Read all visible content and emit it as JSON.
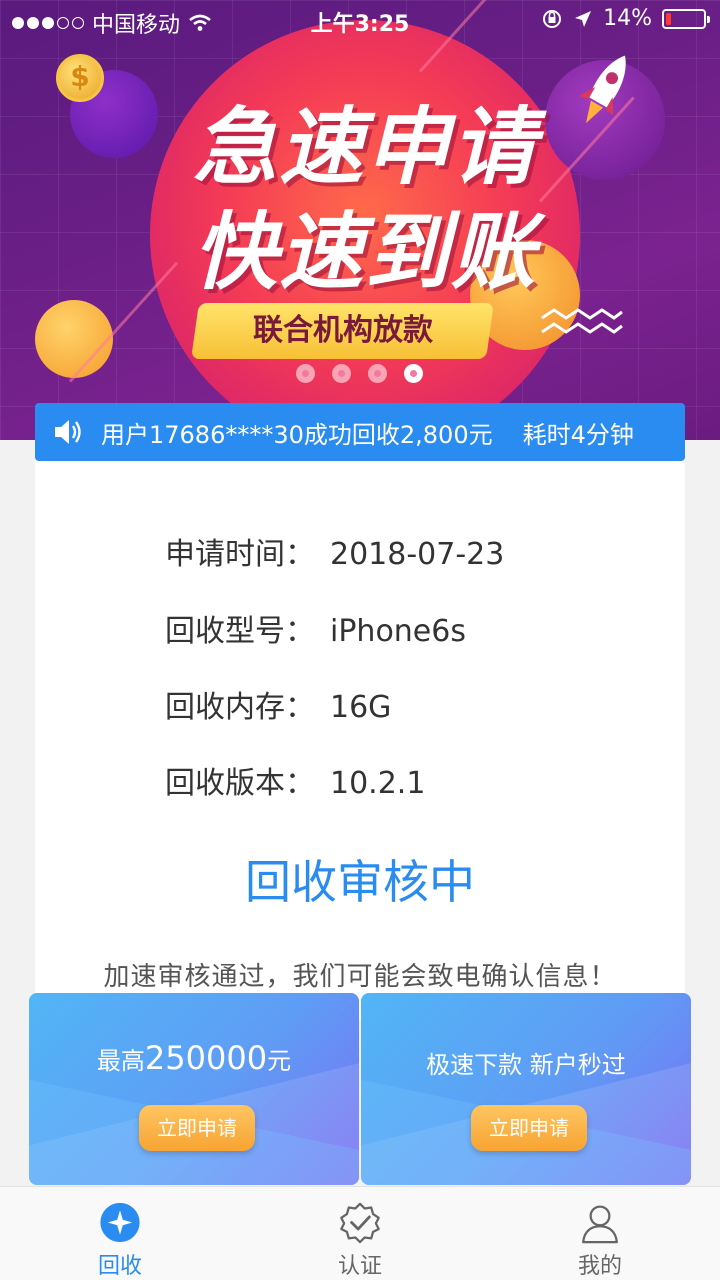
{
  "status_bar": {
    "carrier": "中国移动",
    "time": "上午3:25",
    "battery_percent": "14%",
    "battery_level": 0.14,
    "battery_color": "#ff3b30"
  },
  "banner": {
    "headline_line1": "急速申请",
    "headline_line2": "快速到账",
    "tag": "联合机构放款",
    "carousel_dots": 4,
    "active_dot": 4
  },
  "notice": {
    "message": "用户17686****30成功回收2,800元",
    "duration": "耗时4分钟"
  },
  "info": {
    "rows": [
      {
        "label": "申请时间：",
        "value": "2018-07-23"
      },
      {
        "label": "回收型号：",
        "value": "iPhone6s"
      },
      {
        "label": "回收内存：",
        "value": "16G"
      },
      {
        "label": "回收版本：",
        "value": "10.2.1"
      }
    ],
    "status": "回收审核中",
    "hint": "加速审核通过，我们可能会致电确认信息！"
  },
  "promos": [
    {
      "title_prefix": "最高",
      "title_amount": "250000",
      "title_suffix": "元",
      "button": "立即申请"
    },
    {
      "title": "极速下款 新户秒过",
      "button": "立即申请"
    }
  ],
  "tabbar": {
    "tabs": [
      {
        "label": "回收",
        "icon": "recycle-icon",
        "active": true
      },
      {
        "label": "认证",
        "icon": "verify-badge-icon",
        "active": false
      },
      {
        "label": "我的",
        "icon": "user-icon",
        "active": false
      }
    ]
  },
  "colors": {
    "accent": "#2a8cf0",
    "banner_purple": "#6a1f86",
    "promo_button": "#f7a432"
  }
}
